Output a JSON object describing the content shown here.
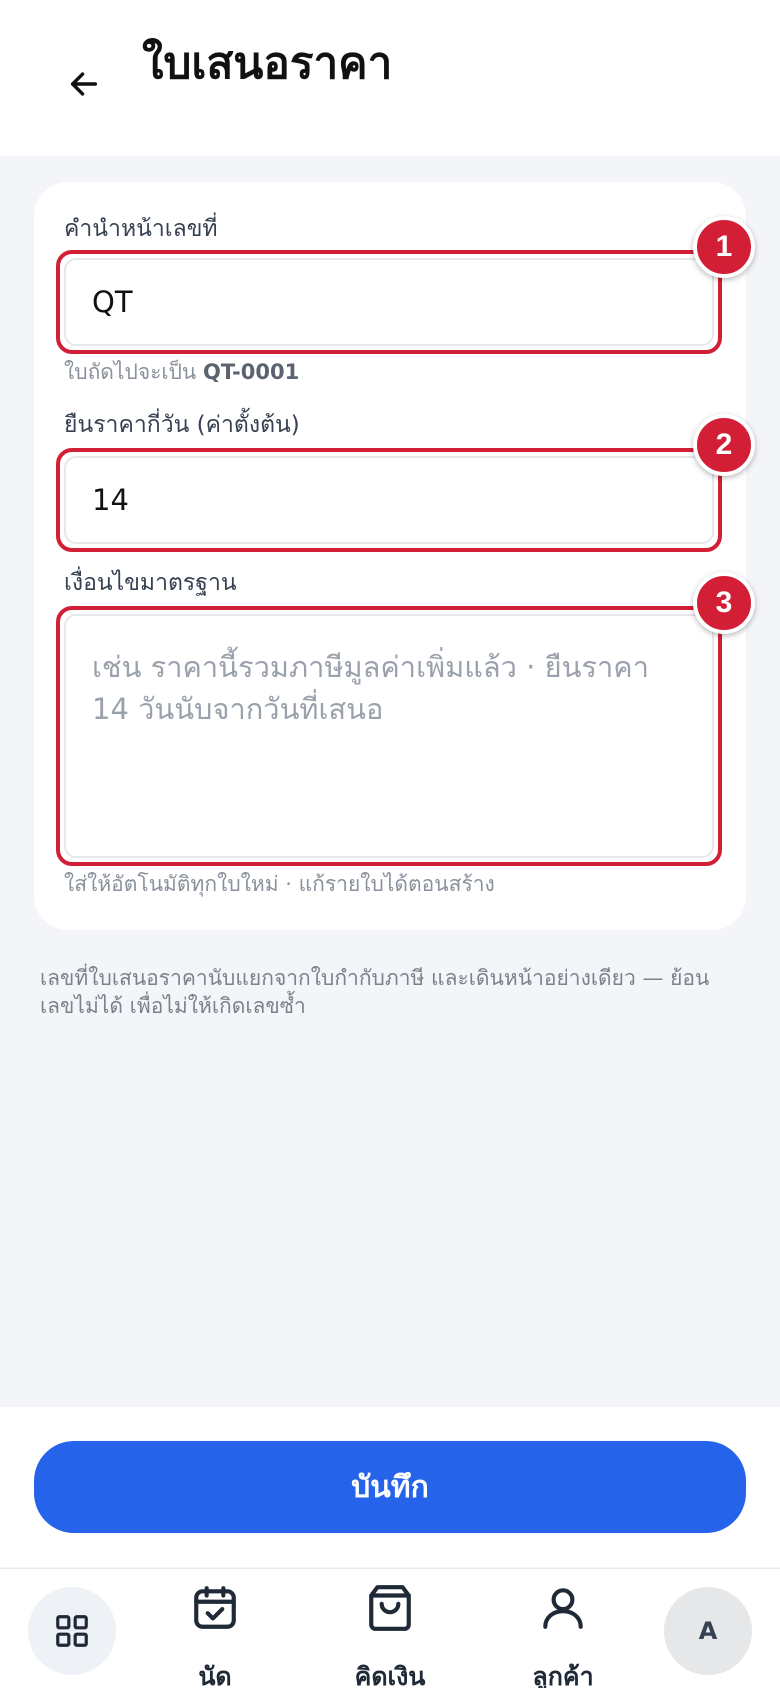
{
  "header": {
    "title": "ใบเสนอราคา",
    "back_icon": "arrow-left-icon"
  },
  "form": {
    "prefix": {
      "label": "คำนำหน้าเลขที่",
      "value": "QT",
      "hint_prefix": "ใบถัดไปจะเป็น",
      "hint_next_number": "QT-0001",
      "badge": "1"
    },
    "validity": {
      "label": "ยืนราคากี่วัน (ค่าตั้งต้น)",
      "value": "14",
      "badge": "2"
    },
    "terms": {
      "label": "เงื่อนไขมาตรฐาน",
      "value": "",
      "placeholder": "เช่น ราคานี้รวมภาษีมูลค่าเพิ่มแล้ว · ยืนราคา 14 วันนับจากวันที่เสนอ",
      "hint": "ใส่ให้อัตโนมัติทุกใบใหม่ · แก้รายใบได้ตอนสร้าง",
      "badge": "3"
    }
  },
  "note": "เลขที่ใบเสนอราคานับแยกจากใบกำกับภาษี และเดินหน้าอย่างเดียว — ย้อนเลขไม่ได้ เพื่อไม่ให้เกิดเลขซ้ำ",
  "save_label": "บันทึก",
  "tabbar": {
    "home_icon": "grid-icon",
    "items": [
      {
        "label": "นัด",
        "icon": "calendar-check-icon"
      },
      {
        "label": "คิดเงิน",
        "icon": "shopping-bag-icon"
      },
      {
        "label": "ลูกค้า",
        "icon": "user-icon"
      }
    ],
    "avatar_initial": "A"
  },
  "colors": {
    "accent": "#2563eb",
    "highlight": "#d31f35",
    "background": "#f3f5f9"
  }
}
